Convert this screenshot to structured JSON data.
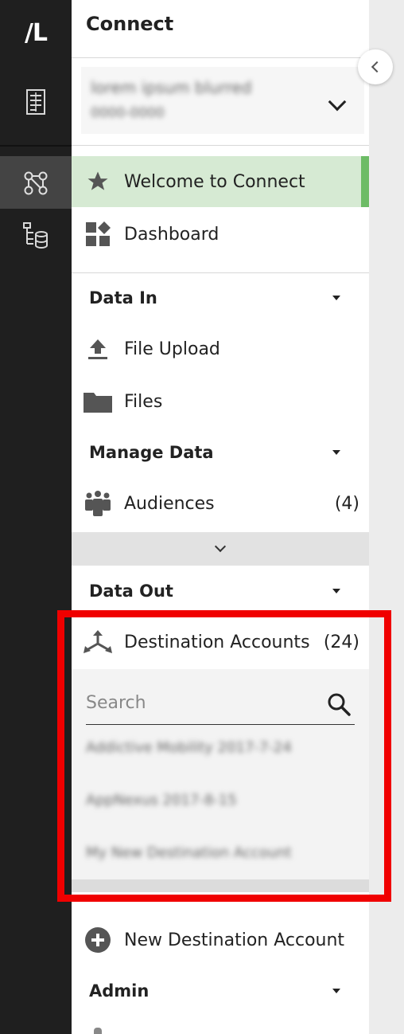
{
  "rail": {
    "logo": "/L",
    "icons": [
      "document-icon",
      "workflow-icon",
      "data-tree-icon"
    ]
  },
  "header": {
    "title": "Connect",
    "account_name": "lorem ipsum blurred",
    "account_id": "0000-0000"
  },
  "nav": {
    "welcome": "Welcome to Connect",
    "dashboard": "Dashboard"
  },
  "data_in": {
    "title": "Data In",
    "file_upload": "File Upload",
    "files": "Files"
  },
  "manage_data": {
    "title": "Manage Data",
    "audiences": "Audiences",
    "audiences_count": "(4)"
  },
  "data_out": {
    "title": "Data Out",
    "destination_accounts": "Destination Accounts",
    "destination_accounts_count": "(24)",
    "search_placeholder": "Search",
    "items": [
      "Addictive Mobility 2017-7-24",
      "AppNexus 2017-8-15",
      "My New Destination Account"
    ],
    "new_destination": "New Destination Account"
  },
  "admin": {
    "title": "Admin"
  },
  "colors": {
    "rail": "#1f1f1f",
    "active": "#d6ead3",
    "active_bar": "#6dbc66",
    "highlight": "#f00000"
  }
}
